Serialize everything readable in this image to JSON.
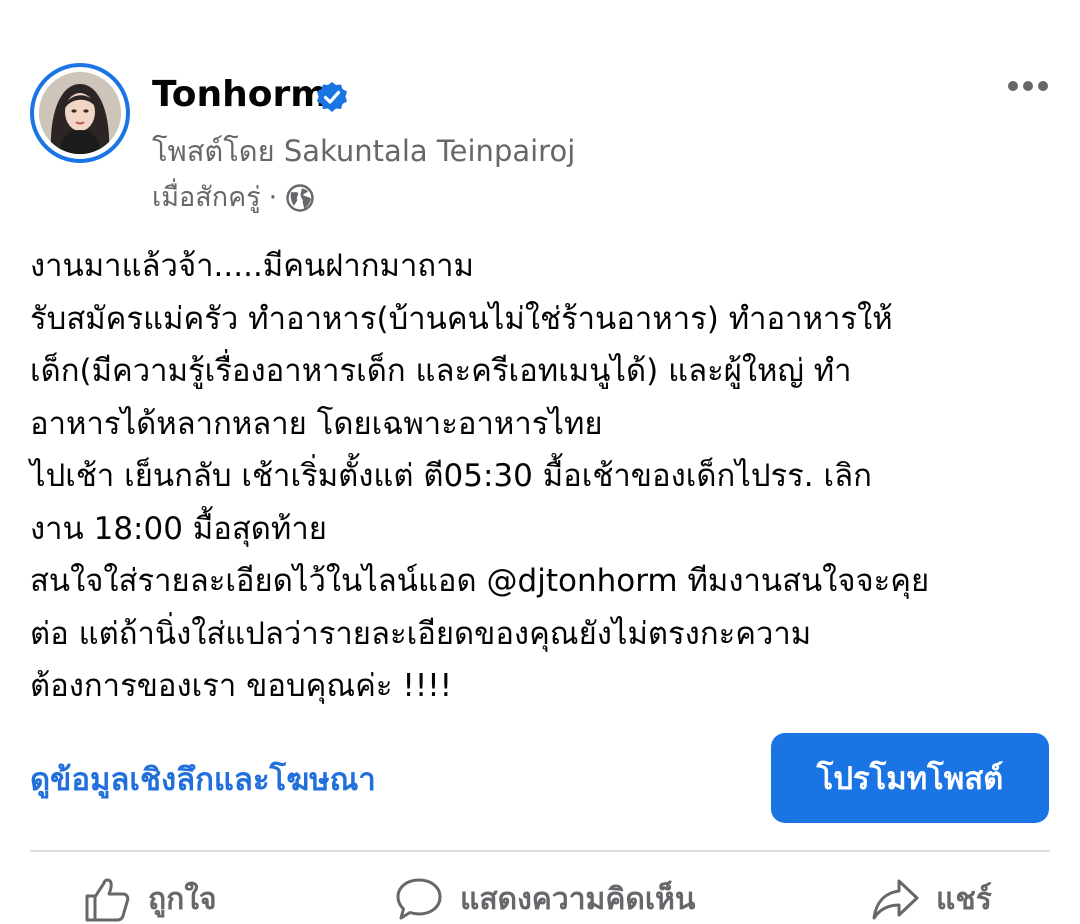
{
  "post": {
    "page_name": "Tonhorm",
    "posted_by": "โพสต์โดย Sakuntala Teinpairoj",
    "time": "เมื่อสักครู่",
    "separator": "·",
    "icons": {
      "verified": "verified-badge-icon",
      "audience": "globe-icon",
      "more": "more-options-icon"
    },
    "body_lines": [
      "งานมาแล้วจ้า.....มีคนฝากมาถาม",
      "รับสมัครแม่ครัว ทำอาหาร(บ้านคนไม่ใช่ร้านอาหาร) ทำอาหารให้",
      "เด็ก(มีความรู้เรื่องอาหารเด็ก และครีเอทเมนูได้) และผู้ใหญ่ ทำ",
      "อาหารได้หลากหลาย โดยเฉพาะอาหารไทย",
      "ไปเช้า เย็นกลับ เช้าเริ่มตั้งแต่ ตี05:30 มื้อเช้าของเด็กไปรร. เลิก",
      "งาน 18:00 มื้อสุดท้าย",
      "สนใจใส่รายละเอียดไว้ในไลน์แอด @djtonhorm ทีมงานสนใจจะคุย",
      "ต่อ แต่ถ้านิ่งใส่แปลว่ารายละเอียดของคุณยังไม่ตรงกะความ",
      "ต้องการของเรา ขอบคุณค่ะ !!!!"
    ]
  },
  "actions": {
    "insights_label": "ดูข้อมูลเชิงลึกและโฆษณา",
    "promote_label": "โปรโมทโพสต์",
    "like_label": "ถูกใจ",
    "comment_label": "แสดงความคิดเห็น",
    "share_label": "แชร์"
  },
  "colors": {
    "accent": "#1b74e4",
    "link": "#216fdb",
    "secondary_text": "#65676b",
    "primary_text": "#050505",
    "divider": "#dadde1"
  }
}
